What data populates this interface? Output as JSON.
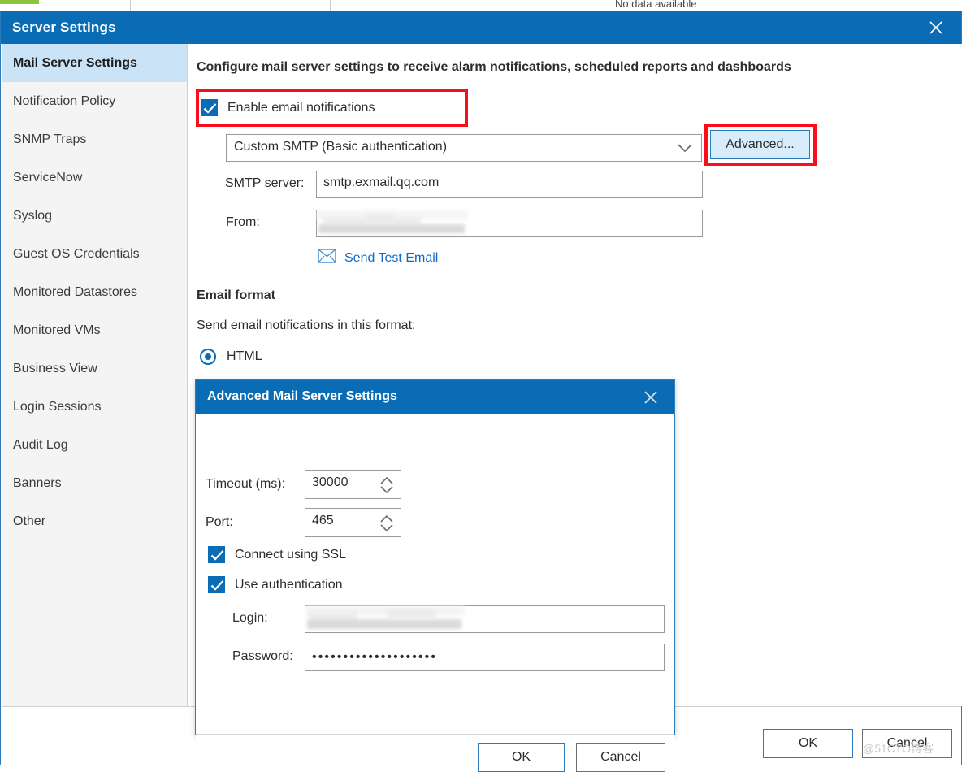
{
  "background": {
    "no_data_text": "No data available",
    "accent_green": "#8cc63e"
  },
  "window": {
    "title": "Server Settings",
    "titlebar_color": "#0a6cb4",
    "close_icon": "close-icon"
  },
  "sidebar": {
    "selected_index": 0,
    "items": [
      {
        "label": "Mail Server Settings"
      },
      {
        "label": "Notification Policy"
      },
      {
        "label": "SNMP Traps"
      },
      {
        "label": "ServiceNow"
      },
      {
        "label": "Syslog"
      },
      {
        "label": "Guest OS Credentials"
      },
      {
        "label": "Monitored Datastores"
      },
      {
        "label": "Monitored VMs"
      },
      {
        "label": "Business View"
      },
      {
        "label": "Login Sessions"
      },
      {
        "label": "Audit Log"
      },
      {
        "label": "Banners"
      },
      {
        "label": "Other"
      }
    ]
  },
  "main": {
    "heading": "Configure mail server settings to receive alarm notifications, scheduled reports and dashboards",
    "enable_email": {
      "label": "Enable email notifications",
      "checked": true,
      "highlight_color": "#fc0d1b"
    },
    "smtp_type": {
      "selected": "Custom SMTP (Basic authentication)",
      "chevron_icon": "chevron-down-icon"
    },
    "advanced_button": {
      "label": "Advanced...",
      "highlight_color": "#fc0d1b"
    },
    "smtp_server": {
      "label": "SMTP server:",
      "value": "smtp.exmail.qq.com",
      "placeholder": ""
    },
    "from": {
      "label": "From:",
      "value": "",
      "placeholder": "",
      "redacted": true
    },
    "send_test_email": {
      "label": "Send Test Email",
      "icon": "envelope-icon",
      "link_color": "#1268c4"
    },
    "email_format": {
      "heading": "Email format",
      "subtitle": "Send email notifications in this format:",
      "options": [
        {
          "label": "HTML",
          "selected": true
        }
      ]
    }
  },
  "footer": {
    "ok_label": "OK",
    "cancel_label": "Cancel"
  },
  "advanced_dialog": {
    "title": "Advanced Mail Server Settings",
    "close_icon": "close-icon",
    "timeout": {
      "label": "Timeout (ms):",
      "value": "30000"
    },
    "port": {
      "label": "Port:",
      "value": "465"
    },
    "connect_ssl": {
      "label": "Connect using SSL",
      "checked": true
    },
    "use_auth": {
      "label": "Use authentication",
      "checked": true
    },
    "login": {
      "label": "Login:",
      "value": "",
      "placeholder": "",
      "redacted": true
    },
    "password": {
      "label": "Password:",
      "value": "••••••••••••••••••••",
      "masked": true
    },
    "ok_label": "OK",
    "cancel_label": "Cancel"
  },
  "watermark": {
    "text": "@51CTO博客"
  }
}
